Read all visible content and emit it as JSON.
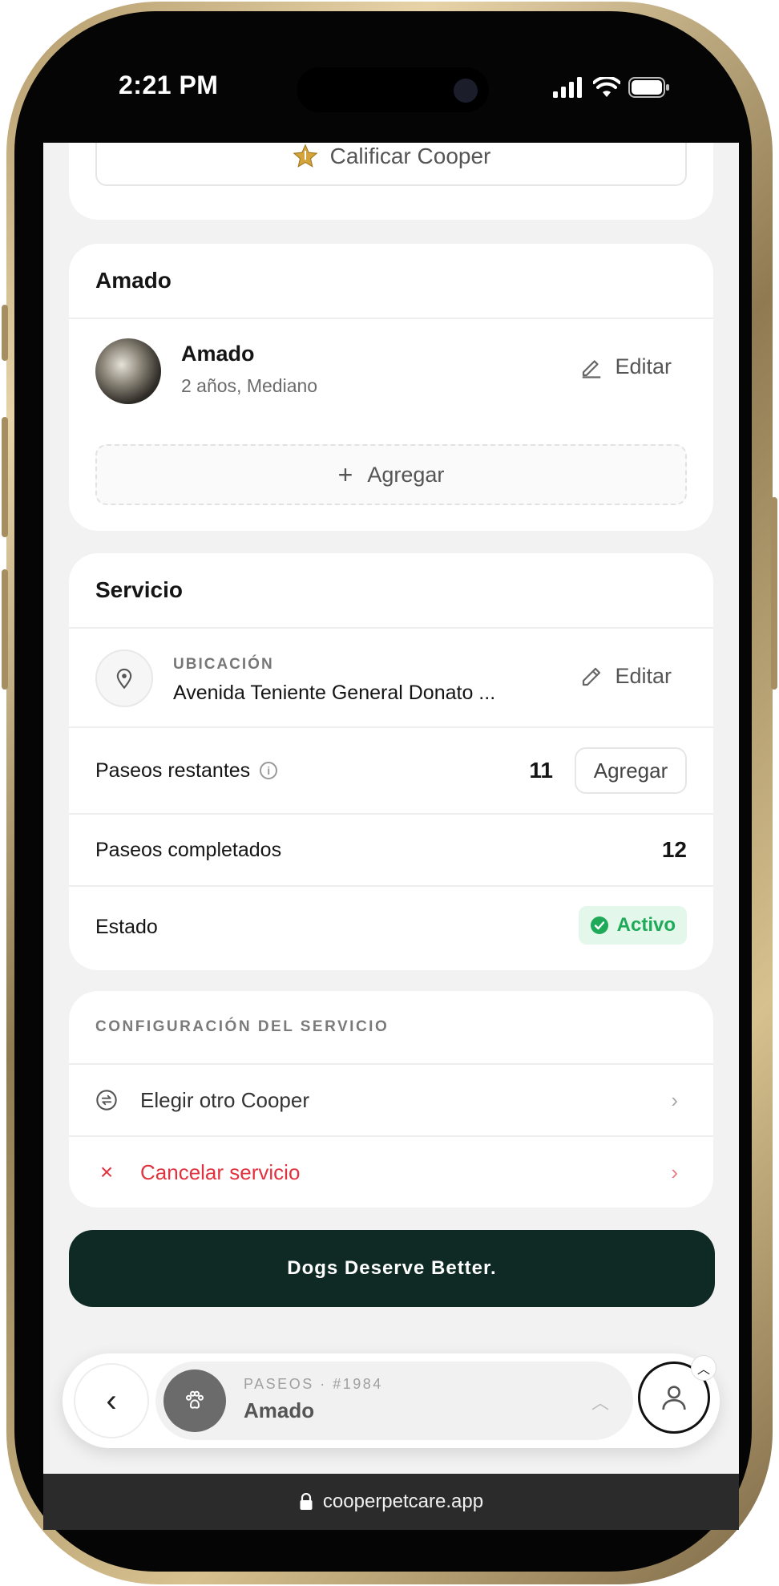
{
  "status_bar": {
    "time": "2:21 PM"
  },
  "rate": {
    "label": "Calificar Cooper"
  },
  "pet_card": {
    "title": "Amado",
    "pet_name": "Amado",
    "pet_details": "2 años, Mediano",
    "edit_label": "Editar",
    "add_label": "Agregar"
  },
  "service_card": {
    "title": "Servicio",
    "location_label": "UBICACIÓN",
    "location_value": "Avenida Teniente General Donato ...",
    "edit_label": "Editar",
    "remaining_label": "Paseos restantes",
    "remaining_value": "11",
    "add_label": "Agregar",
    "completed_label": "Paseos completados",
    "completed_value": "12",
    "status_label": "Estado",
    "status_value": "Activo"
  },
  "config_card": {
    "title": "CONFIGURACIÓN DEL SERVICIO",
    "choose_other": "Elegir otro Cooper",
    "cancel": "Cancelar servicio"
  },
  "banner": {
    "text": "Dogs Deserve Better."
  },
  "bottom_nav": {
    "subtitle": "PASEOS · #1984",
    "title": "Amado"
  },
  "browser": {
    "url": "cooperpetcare.app"
  },
  "colors": {
    "accent_dark": "#0f2a24",
    "success": "#1faa59",
    "success_bg": "#e3f7ea",
    "danger": "#e0333f",
    "star": "#d4a33b"
  }
}
